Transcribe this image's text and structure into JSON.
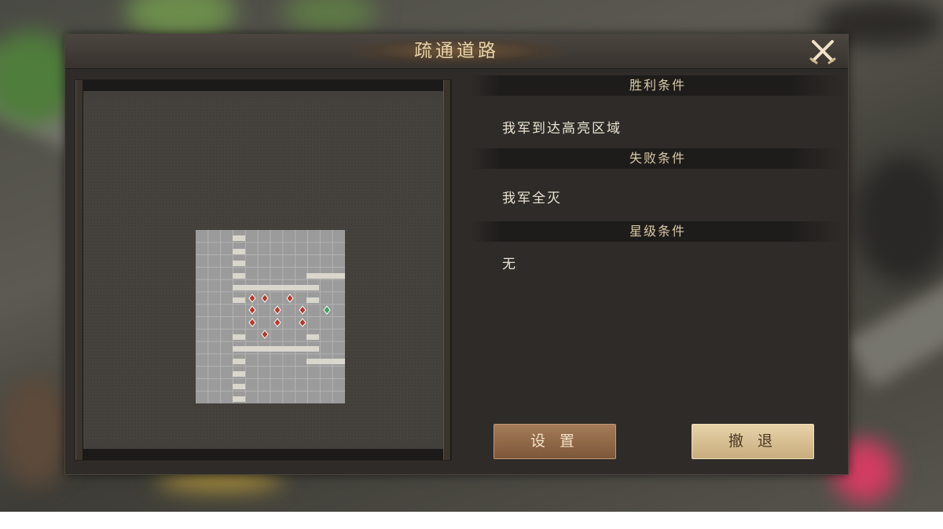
{
  "dialog": {
    "title": "疏通道路",
    "close_icon": "crossed-swords-close-icon"
  },
  "conditions": {
    "victory": {
      "header": "胜利条件",
      "text": "我军到达高亮区域"
    },
    "defeat": {
      "header": "失败条件",
      "text": "我军全灭"
    },
    "star": {
      "header": "星级条件",
      "text": "无"
    }
  },
  "buttons": {
    "settings": "设 置",
    "retreat": "撤 退"
  },
  "map": {
    "grid_columns": 12,
    "grid_rows": 14,
    "enemy_unit_icon": "red-unit-marker-icon",
    "ally_unit_icon": "green-unit-marker-icon",
    "enemy_count": 10,
    "ally_count": 1,
    "colors": {
      "grid": "#9b9b9b",
      "wall": "#d9d6cc",
      "enemy": "#b5392c",
      "ally": "#3fa05a"
    }
  }
}
